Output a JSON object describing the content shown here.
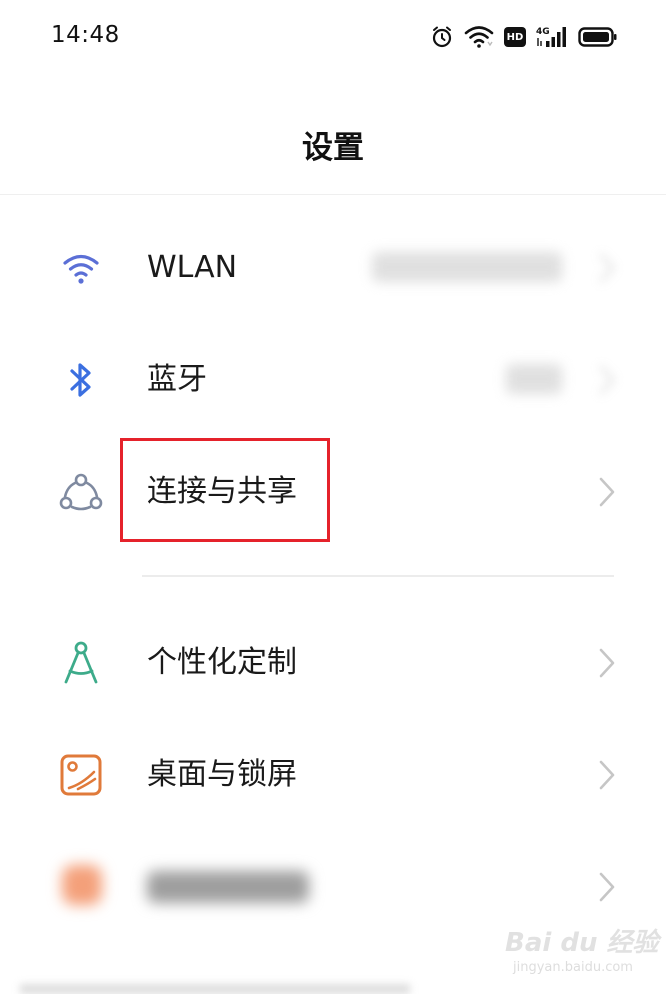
{
  "status_bar": {
    "time": "14:48",
    "icons": [
      "alarm-icon",
      "wifi-status-icon",
      "hd-badge",
      "cellular-4g-icon",
      "battery-icon"
    ],
    "hd_label": "HD",
    "network_label": "4G"
  },
  "header": {
    "title": "设置"
  },
  "settings_items": [
    {
      "label": "WLAN",
      "icon": "wifi-icon",
      "icon_color": "#5b6fd6"
    },
    {
      "label": "蓝牙",
      "icon": "bluetooth-icon",
      "icon_color": "#3b6fe0"
    },
    {
      "label": "连接与共享",
      "icon": "connection-sharing-icon",
      "icon_color": "#7f8aa0",
      "highlighted": true
    },
    {
      "label": "个性化定制",
      "icon": "personalization-compass-icon",
      "icon_color": "#3dab8a"
    },
    {
      "label": "桌面与锁屏",
      "icon": "wallpaper-icon",
      "icon_color": "#e07a3a"
    }
  ],
  "colors": {
    "highlight_border": "#e5222b",
    "chevron": "#c6c6c6",
    "divider": "#ececec"
  },
  "watermark": {
    "brand": "Bai du 经验",
    "url": "jingyan.baidu.com"
  }
}
